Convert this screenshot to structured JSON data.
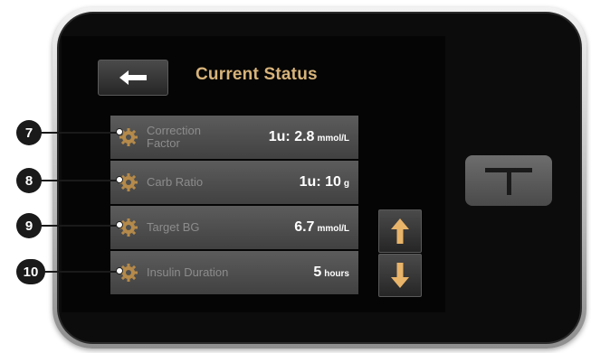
{
  "screen": {
    "title": "Current Status",
    "back_button": "back-arrow-icon"
  },
  "settings": [
    {
      "label_line1": "Correction",
      "label_line2": "Factor",
      "value": "1u: 2.8",
      "unit": "mmol/L"
    },
    {
      "label_line1": "Carb Ratio",
      "label_line2": "",
      "value": "1u: 10",
      "unit": "g"
    },
    {
      "label_line1": "Target BG",
      "label_line2": "",
      "value": "6.7",
      "unit": "mmol/L"
    },
    {
      "label_line1": "Insulin Duration",
      "label_line2": "",
      "value": "5",
      "unit": "hours"
    }
  ],
  "scroll": {
    "up_icon": "arrow-up-icon",
    "down_icon": "arrow-down-icon"
  },
  "callouts": [
    "7",
    "8",
    "9",
    "10"
  ],
  "colors": {
    "title": "#d7b37a",
    "arrow": "#e8b46a",
    "row_bg": "#4f4f4f",
    "label": "#8c8c8c"
  }
}
